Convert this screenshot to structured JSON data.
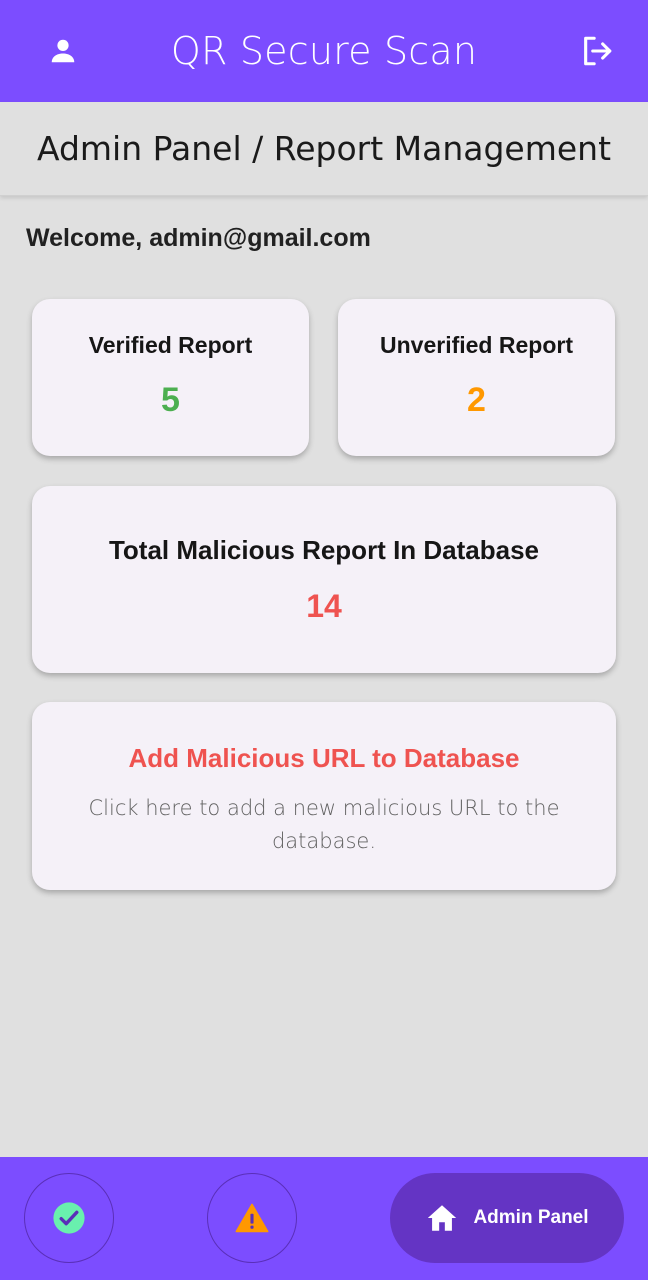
{
  "app": {
    "title": "QR Secure Scan"
  },
  "header": {
    "subtitle": "Admin Panel / Report Management"
  },
  "welcome": {
    "text": "Welcome, admin@gmail.com"
  },
  "stats": {
    "verified": {
      "label": "Verified Report",
      "value": "5",
      "color": "#4caf50"
    },
    "unverified": {
      "label": "Unverified Report",
      "value": "2",
      "color": "#ff9800"
    },
    "total": {
      "label": "Total Malicious Report In Database",
      "value": "14",
      "color": "#ef5350"
    }
  },
  "add_card": {
    "title": "Add Malicious URL to Database",
    "description": "Click here to add a new malicious URL to the database.",
    "title_color": "#ef5350"
  },
  "bottom_nav": {
    "items": [
      {
        "icon": "check-circle-icon",
        "color": "#69f0ae"
      },
      {
        "icon": "warning-icon",
        "color": "#ff9800"
      },
      {
        "icon": "home-icon",
        "label": "Admin Panel",
        "active": true
      }
    ]
  },
  "colors": {
    "primary": "#7c4dff",
    "active_nav": "#6434c4",
    "background": "#e0e0e0"
  }
}
